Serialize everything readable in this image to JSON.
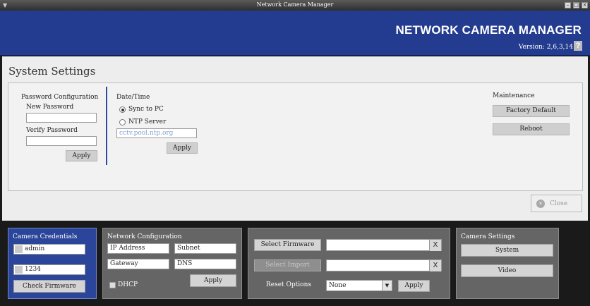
{
  "window": {
    "title": "Network Camera Manager"
  },
  "header": {
    "brand": "NETWORK CAMERA MANAGER",
    "version": "Version: 2,6,3,14",
    "help_glyph": "?"
  },
  "main": {
    "page_title": "System Settings",
    "password": {
      "section_label": "Password Configuration",
      "new_label": "New Password",
      "new_value": "",
      "verify_label": "Verify Password",
      "verify_value": "",
      "apply": "Apply"
    },
    "datetime": {
      "section_label": "Date/Time",
      "sync_label": "Sync to PC",
      "sync_selected": true,
      "ntp_label": "NTP Server",
      "ntp_placeholder": "cctv.pool.ntp.org",
      "apply": "Apply"
    },
    "maintenance": {
      "section_label": "Maintenance",
      "factory_default": "Factory Default",
      "reboot": "Reboot"
    },
    "close": "Close"
  },
  "credentials": {
    "title": "Camera Credentials",
    "username": "admin",
    "password": "1234",
    "check_firmware": "Check Firmware"
  },
  "network": {
    "title": "Network Configuration",
    "ip_placeholder": "IP Address",
    "subnet_placeholder": "Subnet",
    "gateway_placeholder": "Gateway",
    "dns_placeholder": "DNS",
    "dhcp_label": "DHCP",
    "apply": "Apply"
  },
  "firmware": {
    "select_firmware": "Select Firmware",
    "select_import": "Select Import",
    "clear_glyph": "X",
    "reset_options_label": "Reset Options",
    "reset_option_value": "None",
    "apply": "Apply"
  },
  "camera_settings": {
    "title": "Camera Settings",
    "system": "System",
    "video": "Video"
  },
  "colors": {
    "header_blue": "#243c8f",
    "panel_gray": "#656565",
    "accent_blue": "#2a4599"
  }
}
